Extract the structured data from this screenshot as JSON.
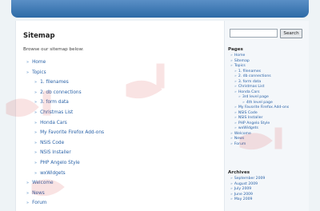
{
  "page": {
    "title": "Sitemap",
    "intro": "Browse our sitemap below:"
  },
  "sitemap": {
    "home": "Home",
    "topics": "Topics",
    "topic_items": [
      "1. filenames",
      "2. db connections",
      "3. form data",
      "Christmas List",
      "Honda Cars",
      "My Favorite Firefox Add-ons",
      "NSIS Code",
      "NSIS Installer",
      "PHP Angelo Style",
      "wxWidgets"
    ],
    "welcome": "Welcome",
    "news": "News",
    "forum": "Forum"
  },
  "search": {
    "value": "",
    "button_label": "Search"
  },
  "sidebar": {
    "pages_title": "Pages",
    "pages": {
      "home": "Home",
      "sitemap": "Sitemap",
      "topics": "Topics",
      "topic_items": [
        "1. filenames",
        "2. db connections",
        "3. form data",
        "Christmas List",
        "Honda Cars"
      ],
      "third_level": "3rd level page",
      "fourth_level": "4th level page",
      "after_items": [
        "My Favorite Firefox Add-ons",
        "NSIS Code",
        "NSIS Installer",
        "PHP Angelo Style",
        "wxWidgets"
      ],
      "welcome": "Welcome",
      "news": "News",
      "forum": "Forum"
    },
    "archives_title": "Archives",
    "archives": [
      "September 2009",
      "August 2009",
      "July 2009",
      "June 2009",
      "May 2009"
    ]
  },
  "colors": {
    "header": "#3b78b6",
    "link": "#2b63a8",
    "background": "#eef3f6"
  },
  "watermark": {
    "logo_text": "سرير",
    "icon_name": "watermark-logo"
  }
}
